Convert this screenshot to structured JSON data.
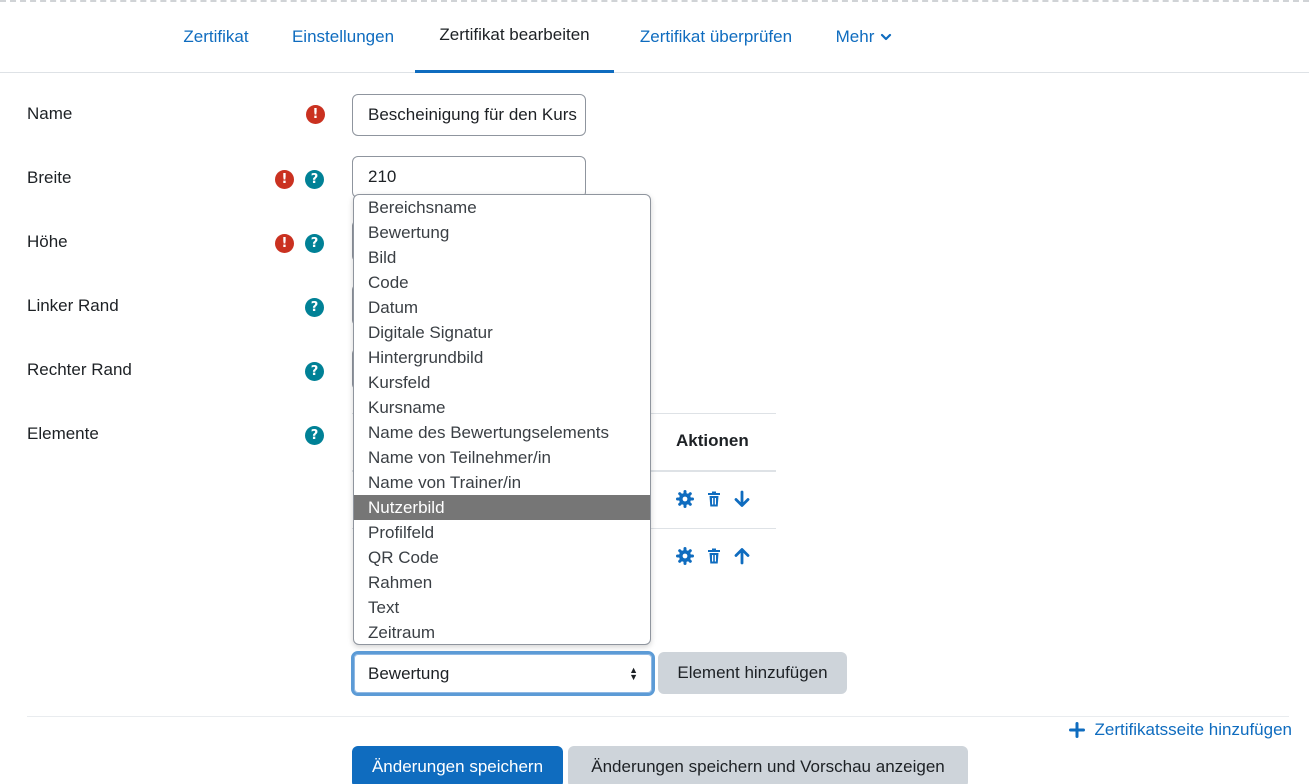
{
  "nav": {
    "tabs": [
      {
        "label": "Zertifikat",
        "active": false
      },
      {
        "label": "Einstellungen",
        "active": false
      },
      {
        "label": "Zertifikat bearbeiten",
        "active": true
      },
      {
        "label": "Zertifikat überprüfen",
        "active": false
      },
      {
        "label": "Mehr",
        "active": false,
        "icon": "chevron-down-icon"
      }
    ]
  },
  "form": {
    "name": {
      "label": "Name",
      "value": "Bescheinigung für den Kurs",
      "required": true,
      "help": false
    },
    "breite": {
      "label": "Breite",
      "value": "210",
      "required": true,
      "help": true
    },
    "hoehe": {
      "label": "Höhe",
      "required": true,
      "help": true
    },
    "linker_rand": {
      "label": "Linker Rand",
      "required": false,
      "help": true
    },
    "rechter_rand": {
      "label": "Rechter Rand",
      "required": false,
      "help": true
    },
    "elemente": {
      "label": "Elemente",
      "required": false,
      "help": true
    }
  },
  "table": {
    "actions_header": "Aktionen",
    "rows": [
      {
        "actions": [
          "gear-icon",
          "trash-icon",
          "arrow-down-icon"
        ]
      },
      {
        "actions": [
          "gear-icon",
          "trash-icon",
          "arrow-up-icon"
        ]
      }
    ]
  },
  "dropdown": {
    "options": [
      "Bereichsname",
      "Bewertung",
      "Bild",
      "Code",
      "Datum",
      "Digitale Signatur",
      "Hintergrundbild",
      "Kursfeld",
      "Kursname",
      "Name des Bewertungselements",
      "Name von Teilnehmer/in",
      "Name von Trainer/in",
      "Nutzerbild",
      "Profilfeld",
      "QR Code",
      "Rahmen",
      "Text",
      "Zeitraum"
    ],
    "highlighted": "Nutzerbild",
    "selected_value": "Bewertung"
  },
  "buttons": {
    "add_element": "Element hinzufügen",
    "add_page": "Zertifikatsseite hinzufügen",
    "save": "Änderungen speichern",
    "save_preview": "Änderungen speichern und Vorschau anzeigen"
  },
  "colors": {
    "accent": "#0f6cbf",
    "required": "#ca3120",
    "help": "#008196",
    "highlight": "#767676"
  }
}
